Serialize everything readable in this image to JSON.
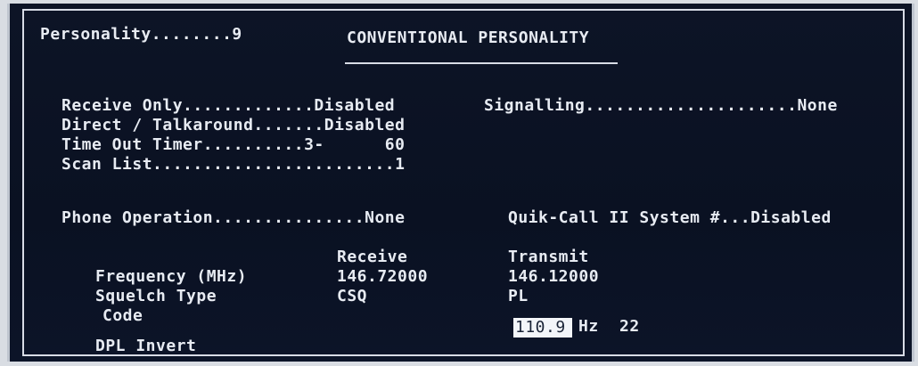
{
  "header": {
    "personality": "Personality........9",
    "title": "CONVENTIONAL PERSONALITY"
  },
  "settings_left": {
    "receive_only": "Receive Only.............Disabled",
    "direct_talkaround": "Direct / Talkaround.......Disabled",
    "time_out_timer": "Time Out Timer..........3-      60",
    "scan_list": "Scan List........................1"
  },
  "settings_right": {
    "signalling": "Signalling.....................None"
  },
  "phone": {
    "phone_operation": "Phone Operation...............None",
    "quik_call": "Quik-Call II System #...Disabled"
  },
  "table": {
    "col_receive": "Receive",
    "col_transmit": "Transmit",
    "row_frequency_label": "Frequency (MHz)",
    "frequency_receive": "146.72000",
    "frequency_transmit": "146.12000",
    "row_squelch_label": "Squelch Type",
    "squelch_receive": "CSQ",
    "squelch_transmit": "PL",
    "row_code_label": "Code",
    "code_value": "110.9",
    "code_unit": "Hz",
    "code_number": "22",
    "row_dpl_label": "DPL Invert"
  },
  "colors": {
    "background": "#0a1122",
    "text": "#e7ebf2",
    "highlight": "#f3f5f9"
  }
}
